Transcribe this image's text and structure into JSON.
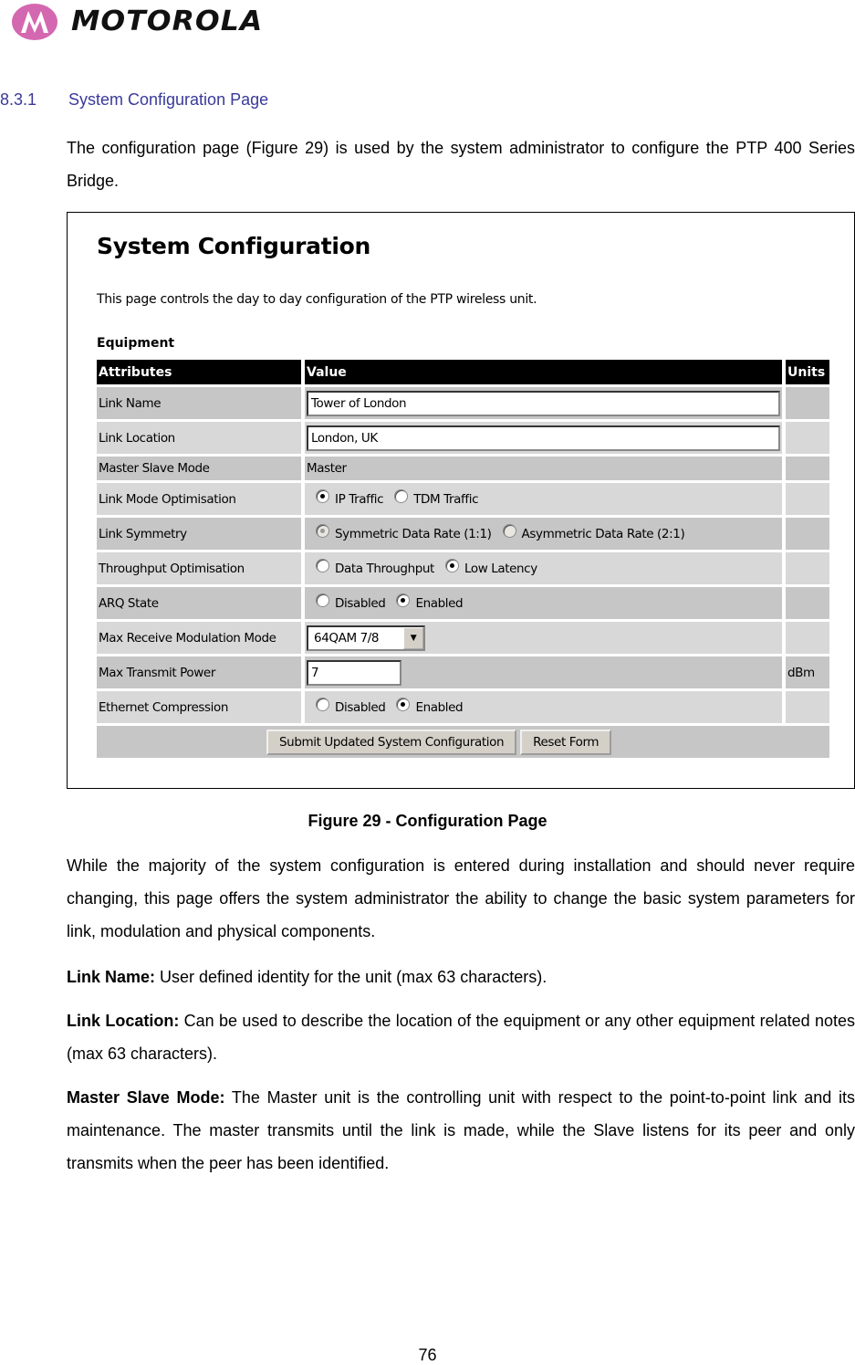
{
  "logo": {
    "brand": "MOTOROLA",
    "icon": "motorola-batwing-logo",
    "color": "#d468b0"
  },
  "section": {
    "number": "8.3.1",
    "title": "System Configuration Page",
    "color": "#3a3a9a"
  },
  "intro": "The configuration page (Figure 29) is used by the system administrator to configure the PTP 400 Series Bridge.",
  "screenshot": {
    "title": "System Configuration",
    "description": "This page controls the day to day configuration of the PTP wireless unit.",
    "group_label": "Equipment",
    "columns": [
      "Attributes",
      "Value",
      "Units"
    ],
    "rows": {
      "link_name": {
        "label": "Link Name",
        "value": "Tower of London",
        "units": ""
      },
      "link_location": {
        "label": "Link Location",
        "value": "London, UK",
        "units": ""
      },
      "master_slave": {
        "label": "Master Slave Mode",
        "value": "Master",
        "units": ""
      },
      "link_mode": {
        "label": "Link Mode Optimisation",
        "options": [
          "IP Traffic",
          "TDM Traffic"
        ],
        "selected": "IP Traffic"
      },
      "link_symmetry": {
        "label": "Link Symmetry",
        "options": [
          "Symmetric Data Rate (1:1)",
          "Asymmetric Data Rate (2:1)"
        ],
        "selected": "Symmetric Data Rate (1:1)",
        "disabled": true
      },
      "throughput": {
        "label": "Throughput Optimisation",
        "options": [
          "Data Throughput",
          "Low Latency"
        ],
        "selected": "Low Latency"
      },
      "arq": {
        "label": "ARQ State",
        "options": [
          "Disabled",
          "Enabled"
        ],
        "selected": "Enabled"
      },
      "modulation": {
        "label": "Max Receive Modulation Mode",
        "value": "64QAM 7/8",
        "units": ""
      },
      "tx_power": {
        "label": "Max Transmit Power",
        "value": "7",
        "units": "dBm"
      },
      "eth_compression": {
        "label": "Ethernet Compression",
        "options": [
          "Disabled",
          "Enabled"
        ],
        "selected": "Enabled"
      }
    },
    "buttons": {
      "submit": "Submit Updated System Configuration",
      "reset": "Reset Form"
    }
  },
  "caption": "Figure 29 - Configuration Page",
  "body": {
    "p1": "While the majority of the system configuration is entered during installation and should never require changing, this page offers the system administrator the ability to change the basic system parameters for link, modulation and physical components.",
    "link_name": {
      "term": "Link Name:",
      "text": " User defined identity for the unit (max 63 characters)."
    },
    "link_location": {
      "term": "Link Location:",
      "text": " Can be used to describe the location of the equipment or any other equipment related notes (max 63 characters)."
    },
    "master_slave": {
      "term": "Master Slave Mode:",
      "text": " The Master unit is the controlling unit with respect to the point-to-point link and its maintenance. The master transmits until the link is made, while the Slave listens for its peer and only transmits when the peer has been identified."
    }
  },
  "page_number": "76"
}
